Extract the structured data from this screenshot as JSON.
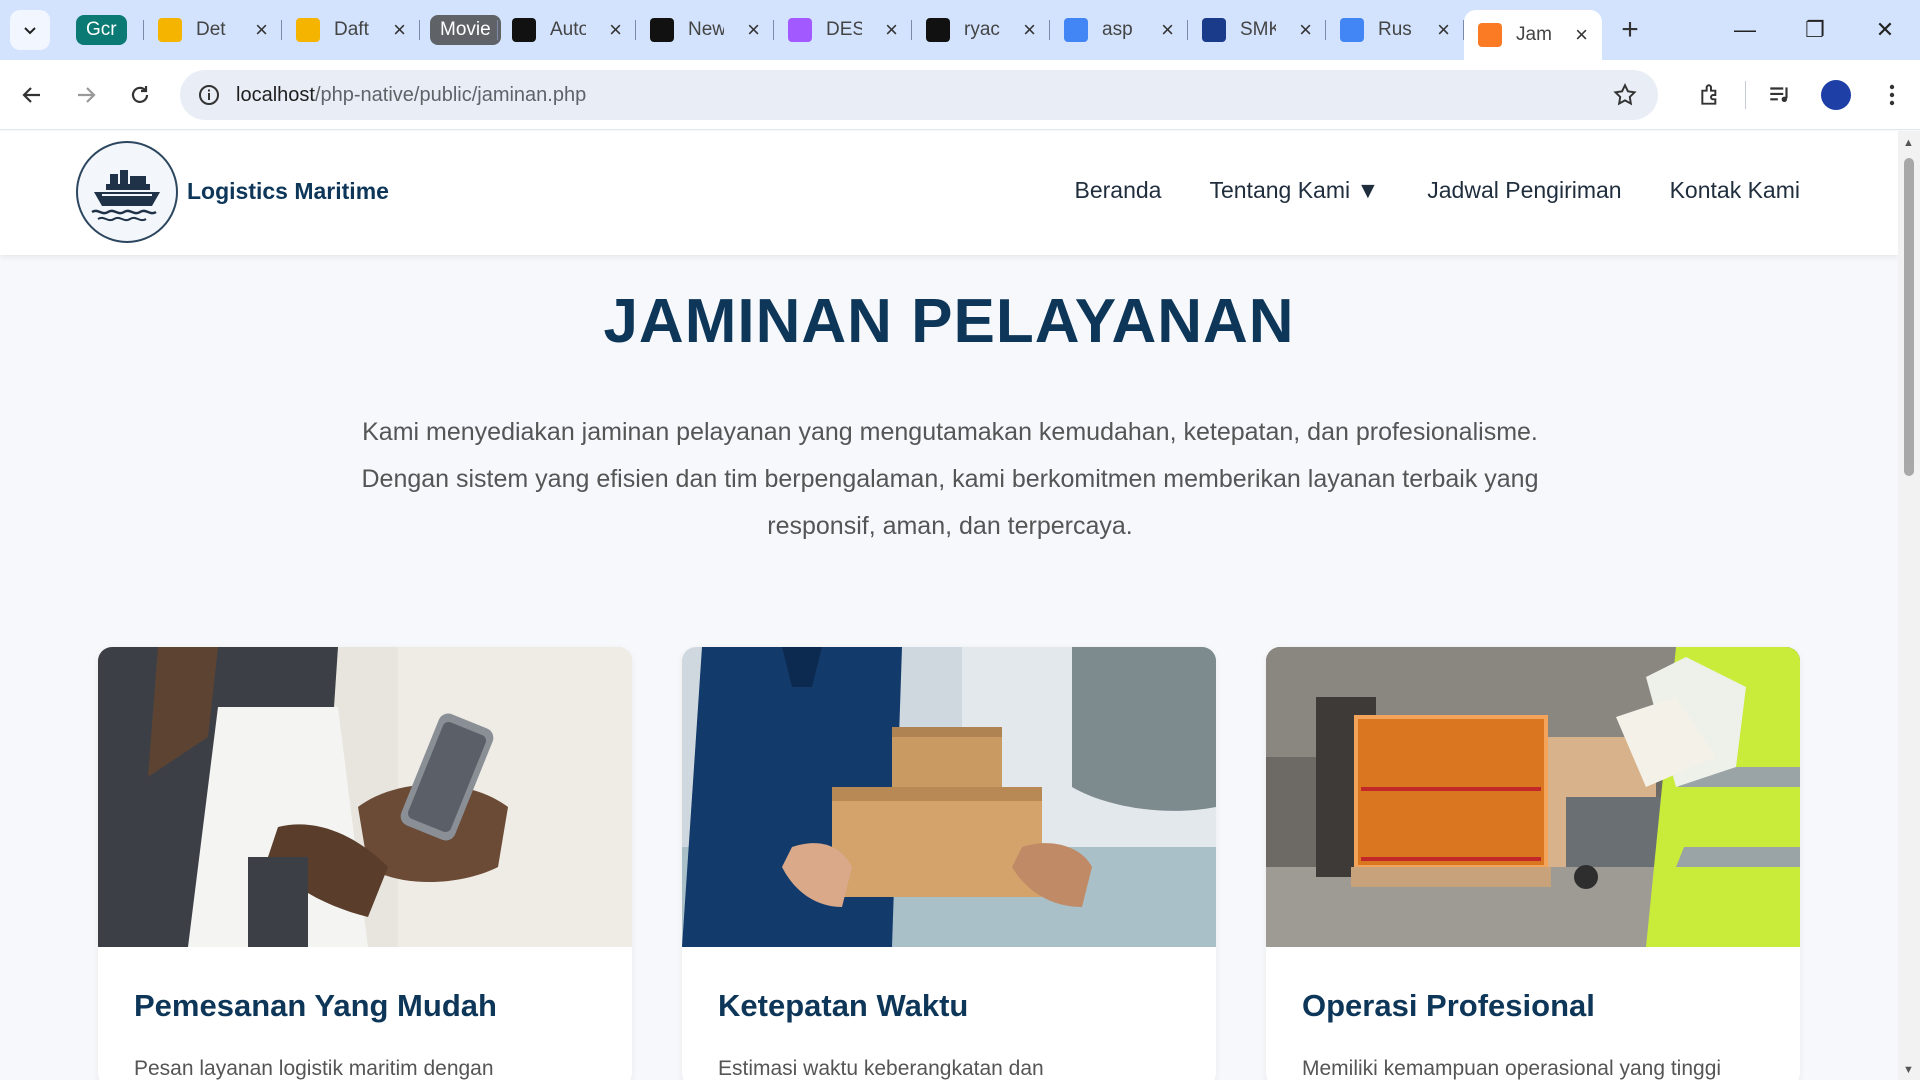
{
  "browser": {
    "tabs": [
      {
        "title": "Gcr",
        "type": "chip",
        "color": "#0b7a75"
      },
      {
        "title": "Det",
        "favicon": "slides-icon",
        "color": "#f4b400"
      },
      {
        "title": "Daft",
        "favicon": "slides-icon",
        "color": "#f4b400"
      },
      {
        "title": "Movie",
        "type": "chip",
        "color": "#5f6368"
      },
      {
        "title": "Auto",
        "favicon": "vo-icon",
        "color": "#111111"
      },
      {
        "title": "New",
        "favicon": "triangle-icon",
        "color": "#111111"
      },
      {
        "title": "DES",
        "favicon": "figma-icon",
        "color": "#a259ff"
      },
      {
        "title": "ryac",
        "favicon": "github-icon",
        "color": "#111111"
      },
      {
        "title": "asp",
        "favicon": "google-icon",
        "color": "#4285f4"
      },
      {
        "title": "SMK",
        "favicon": "shield-icon",
        "color": "#1a3a8a"
      },
      {
        "title": "Rus",
        "favicon": "google-icon",
        "color": "#4285f4"
      },
      {
        "title": "Jam",
        "favicon": "xampp-icon",
        "color": "#fb7a24",
        "active": true
      }
    ],
    "url_host": "localhost",
    "url_path": "/php-native/public/jaminan.php"
  },
  "header": {
    "brand": "Logistics Maritime",
    "nav": [
      "Beranda",
      "Tentang Kami ▼",
      "Jadwal Pengiriman",
      "Kontak Kami"
    ]
  },
  "main": {
    "title": "JAMINAN PELAYANAN",
    "intro": "Kami menyediakan jaminan pelayanan yang mengutamakan kemudahan, ketepatan, dan profesionalisme. Dengan sistem yang efisien dan tim berpengalaman, kami berkomitmen memberikan layanan terbaik yang responsif, aman, dan terpercaya.",
    "cards": [
      {
        "title": "Pemesanan Yang Mudah",
        "text": "Pesan layanan logistik maritim dengan",
        "image": "phone-order-photo"
      },
      {
        "title": "Ketepatan Waktu",
        "text": "Estimasi waktu keberangkatan dan",
        "image": "package-delivery-photo"
      },
      {
        "title": "Operasi Profesional",
        "text": "Memiliki kemampuan operasional yang tinggi",
        "image": "warehouse-inspection-photo"
      }
    ]
  }
}
